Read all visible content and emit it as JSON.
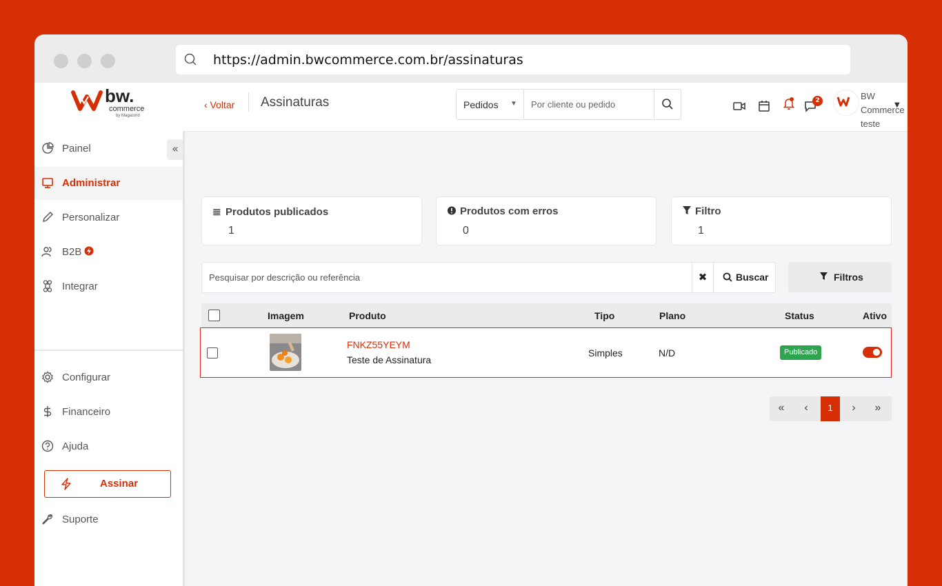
{
  "browser": {
    "url": "https://admin.bwcommerce.com.br/assinaturas"
  },
  "brand": {
    "name": "bw.",
    "tagline": "commerce",
    "sub": "by Magazord",
    "accent": "#d62e05"
  },
  "sidebar": {
    "collapse_label": "«",
    "items": [
      {
        "label": "Painel",
        "icon": "pie-chart-icon"
      },
      {
        "label": "Administrar",
        "icon": "monitor-icon"
      },
      {
        "label": "Personalizar",
        "icon": "pencil-icon"
      },
      {
        "label": "B2B",
        "icon": "users-icon"
      },
      {
        "label": "Integrar",
        "icon": "command-icon"
      },
      {
        "label": "Configurar",
        "icon": "gear-icon"
      },
      {
        "label": "Financeiro",
        "icon": "dollar-icon"
      },
      {
        "label": "Ajuda",
        "icon": "help-icon"
      },
      {
        "label": "Suporte",
        "icon": "wrench-icon"
      }
    ],
    "assinar_label": "Assinar"
  },
  "header": {
    "back_label": "‹ Voltar",
    "title": "Assinaturas",
    "search_scope": "Pedidos",
    "search_placeholder": "Por cliente ou pedido",
    "notification_count": "2",
    "user_name": "BW Commerce",
    "user_sub": "teste"
  },
  "stats": [
    {
      "title": "Produtos publicados",
      "value": "1",
      "icon": "list-icon"
    },
    {
      "title": "Produtos com erros",
      "value": "0",
      "icon": "alert-icon"
    },
    {
      "title": "Filtro",
      "value": "1",
      "icon": "filter-icon"
    }
  ],
  "product_search": {
    "placeholder": "Pesquisar por descrição ou referência",
    "clear_label": "✖",
    "search_label": "Buscar",
    "filters_label": "Filtros"
  },
  "table": {
    "columns": [
      "Imagem",
      "Produto",
      "Tipo",
      "Plano",
      "Status",
      "Ativo"
    ],
    "rows": [
      {
        "ref": "FNKZ55YEYM",
        "name": "Teste de Assinatura",
        "tipo": "Simples",
        "plano": "N/D",
        "status": "Publicado",
        "ativo": true
      }
    ]
  },
  "pagination": {
    "first": "«",
    "prev": "‹",
    "current": "1",
    "next": "›",
    "last": "»"
  }
}
